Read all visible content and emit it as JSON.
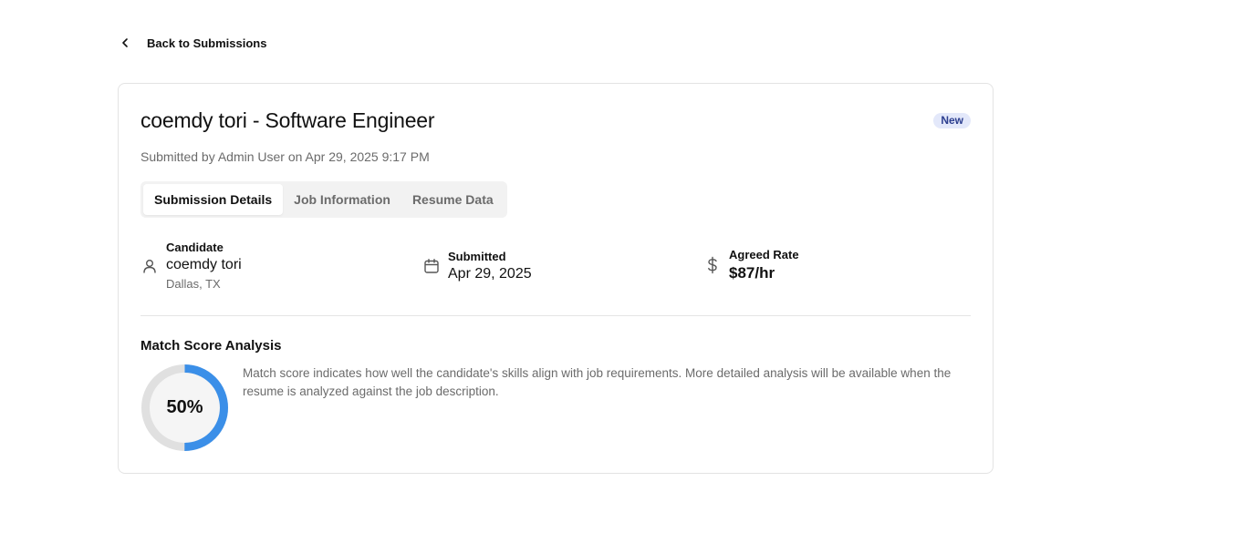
{
  "back": {
    "label": "Back to Submissions",
    "icon": "chevron-left-icon"
  },
  "header": {
    "title": "coemdy tori - Software Engineer",
    "badge": "New",
    "subtitle": "Submitted by Admin User on Apr 29, 2025 9:17 PM"
  },
  "tabs": [
    {
      "label": "Submission Details",
      "active": true
    },
    {
      "label": "Job Information",
      "active": false
    },
    {
      "label": "Resume Data",
      "active": false
    }
  ],
  "candidate": {
    "label": "Candidate",
    "name": "coemdy tori",
    "location": "Dallas, TX",
    "icon": "user-icon"
  },
  "submitted": {
    "label": "Submitted",
    "date": "Apr 29, 2025",
    "icon": "calendar-icon"
  },
  "rate": {
    "label": "Agreed Rate",
    "value": "$87/hr",
    "icon": "dollar-icon"
  },
  "match": {
    "title": "Match Score Analysis",
    "score_text": "50%",
    "score": 0.5,
    "description": "Match score indicates how well the candidate's skills align with job requirements. More detailed analysis will be available when the resume is analyzed against the job description."
  },
  "colors": {
    "accent": "#3b8fe8",
    "track": "#e0e0e0",
    "badge_bg": "#e3e8fa",
    "badge_text": "#2c3e8f"
  }
}
